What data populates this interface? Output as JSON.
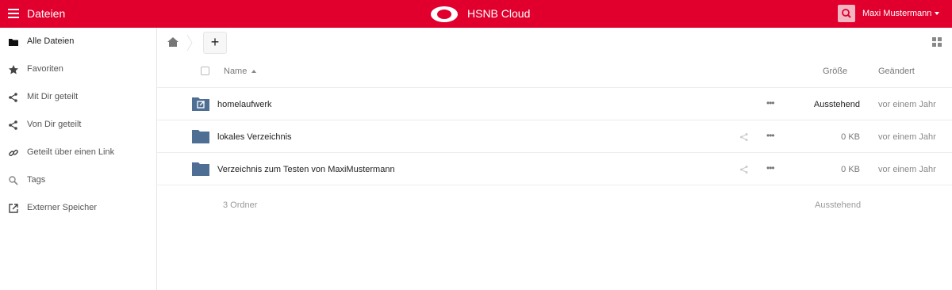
{
  "header": {
    "app_title": "Dateien",
    "brand": "HSNB Cloud",
    "user": "Maxi Mustermann",
    "accent_color": "#e1002d",
    "icons": {
      "menu": "hamburger-icon",
      "logo": "cloud-logo",
      "search": "search-icon",
      "caret": "caret-down-icon"
    }
  },
  "sidebar": {
    "items": [
      {
        "label": "Alle Dateien",
        "icon": "folder-icon",
        "active": true
      },
      {
        "label": "Favoriten",
        "icon": "star-icon"
      },
      {
        "label": "Mit Dir geteilt",
        "icon": "share-icon"
      },
      {
        "label": "Von Dir geteilt",
        "icon": "share-icon"
      },
      {
        "label": "Geteilt über einen Link",
        "icon": "link-icon"
      },
      {
        "label": "Tags",
        "icon": "tag-search-icon"
      },
      {
        "label": "Externer Speicher",
        "icon": "external-link-icon"
      }
    ]
  },
  "controls": {
    "new_label": "+",
    "icons": {
      "home": "home-icon",
      "view": "grid-view-icon"
    }
  },
  "table": {
    "columns": {
      "name": "Name",
      "size": "Größe",
      "modified": "Geändert"
    },
    "rows": [
      {
        "name": "homelaufwerk",
        "size": "Ausstehend",
        "modified": "vor einem Jahr",
        "type": "external-folder"
      },
      {
        "name": "lokales Verzeichnis",
        "size": "0 KB",
        "modified": "vor einem Jahr",
        "type": "folder"
      },
      {
        "name": "Verzeichnis zum Testen von MaxiMustermann",
        "size": "0 KB",
        "modified": "vor einem Jahr",
        "type": "folder"
      }
    ],
    "summary": {
      "count": "3 Ordner",
      "size": "Ausstehend"
    }
  }
}
